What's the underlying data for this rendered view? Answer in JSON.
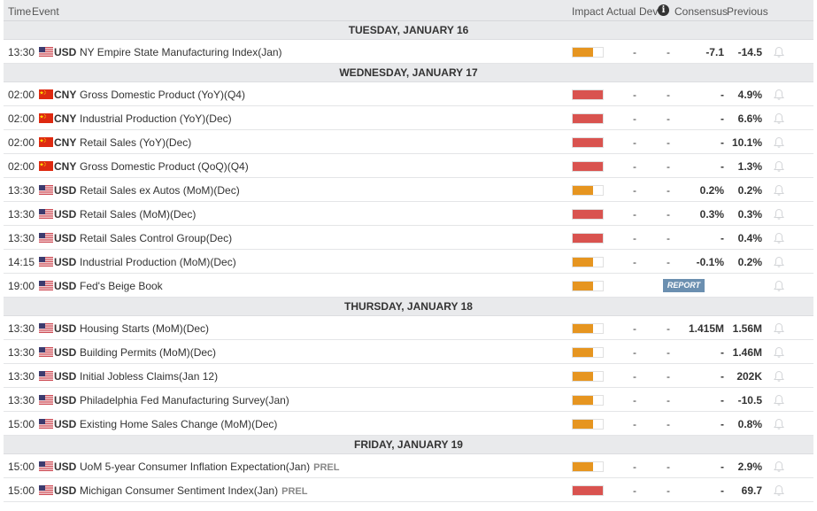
{
  "header": {
    "time": "Time",
    "event": "Event",
    "impact": "Impact",
    "actual": "Actual",
    "dev": "Dev",
    "info_icon": "i",
    "consensus": "Consensus",
    "previous": "Previous"
  },
  "colors": {
    "impact_high": "#d9534f",
    "impact_medium": "#e69520",
    "report_badge": "#6b8fb0"
  },
  "days": [
    {
      "label": "TUESDAY, JANUARY 16",
      "rows": [
        {
          "time": "13:30",
          "flag": "us-flag-icon",
          "ccy": "USD",
          "event": "NY Empire State Manufacturing Index(Jan)",
          "prel": "",
          "impact": "medium",
          "impact_level": 0.67,
          "actual": "-",
          "dev": "-",
          "consensus": "-7.1",
          "previous": "-14.5"
        }
      ]
    },
    {
      "label": "WEDNESDAY, JANUARY 17",
      "rows": [
        {
          "time": "02:00",
          "flag": "cn-flag-icon",
          "ccy": "CNY",
          "event": "Gross Domestic Product (YoY)(Q4)",
          "prel": "",
          "impact": "high",
          "impact_level": 1,
          "actual": "-",
          "dev": "-",
          "consensus": "-",
          "previous": "4.9%"
        },
        {
          "time": "02:00",
          "flag": "cn-flag-icon",
          "ccy": "CNY",
          "event": "Industrial Production (YoY)(Dec)",
          "prel": "",
          "impact": "high",
          "impact_level": 1,
          "actual": "-",
          "dev": "-",
          "consensus": "-",
          "previous": "6.6%"
        },
        {
          "time": "02:00",
          "flag": "cn-flag-icon",
          "ccy": "CNY",
          "event": "Retail Sales (YoY)(Dec)",
          "prel": "",
          "impact": "high",
          "impact_level": 1,
          "actual": "-",
          "dev": "-",
          "consensus": "-",
          "previous": "10.1%"
        },
        {
          "time": "02:00",
          "flag": "cn-flag-icon",
          "ccy": "CNY",
          "event": "Gross Domestic Product (QoQ)(Q4)",
          "prel": "",
          "impact": "high",
          "impact_level": 1,
          "actual": "-",
          "dev": "-",
          "consensus": "-",
          "previous": "1.3%"
        },
        {
          "time": "13:30",
          "flag": "us-flag-icon",
          "ccy": "USD",
          "event": "Retail Sales ex Autos (MoM)(Dec)",
          "prel": "",
          "impact": "medium",
          "impact_level": 0.67,
          "actual": "-",
          "dev": "-",
          "consensus": "0.2%",
          "previous": "0.2%"
        },
        {
          "time": "13:30",
          "flag": "us-flag-icon",
          "ccy": "USD",
          "event": "Retail Sales (MoM)(Dec)",
          "prel": "",
          "impact": "high",
          "impact_level": 1,
          "actual": "-",
          "dev": "-",
          "consensus": "0.3%",
          "previous": "0.3%"
        },
        {
          "time": "13:30",
          "flag": "us-flag-icon",
          "ccy": "USD",
          "event": "Retail Sales Control Group(Dec)",
          "prel": "",
          "impact": "high",
          "impact_level": 1,
          "actual": "-",
          "dev": "-",
          "consensus": "-",
          "previous": "0.4%"
        },
        {
          "time": "14:15",
          "flag": "us-flag-icon",
          "ccy": "USD",
          "event": "Industrial Production (MoM)(Dec)",
          "prel": "",
          "impact": "medium",
          "impact_level": 0.67,
          "actual": "-",
          "dev": "-",
          "consensus": "-0.1%",
          "previous": "0.2%"
        },
        {
          "time": "19:00",
          "flag": "us-flag-icon",
          "ccy": "USD",
          "event": "Fed's Beige Book",
          "prel": "",
          "impact": "medium",
          "impact_level": 0.67,
          "report": "REPORT"
        }
      ]
    },
    {
      "label": "THURSDAY, JANUARY 18",
      "rows": [
        {
          "time": "13:30",
          "flag": "us-flag-icon",
          "ccy": "USD",
          "event": "Housing Starts (MoM)(Dec)",
          "prel": "",
          "impact": "medium",
          "impact_level": 0.67,
          "actual": "-",
          "dev": "-",
          "consensus": "1.415M",
          "previous": "1.56M"
        },
        {
          "time": "13:30",
          "flag": "us-flag-icon",
          "ccy": "USD",
          "event": "Building Permits (MoM)(Dec)",
          "prel": "",
          "impact": "medium",
          "impact_level": 0.67,
          "actual": "-",
          "dev": "-",
          "consensus": "-",
          "previous": "1.46M"
        },
        {
          "time": "13:30",
          "flag": "us-flag-icon",
          "ccy": "USD",
          "event": "Initial Jobless Claims(Jan 12)",
          "prel": "",
          "impact": "medium",
          "impact_level": 0.67,
          "actual": "-",
          "dev": "-",
          "consensus": "-",
          "previous": "202K"
        },
        {
          "time": "13:30",
          "flag": "us-flag-icon",
          "ccy": "USD",
          "event": "Philadelphia Fed Manufacturing Survey(Jan)",
          "prel": "",
          "impact": "medium",
          "impact_level": 0.67,
          "actual": "-",
          "dev": "-",
          "consensus": "-",
          "previous": "-10.5"
        },
        {
          "time": "15:00",
          "flag": "us-flag-icon",
          "ccy": "USD",
          "event": "Existing Home Sales Change (MoM)(Dec)",
          "prel": "",
          "impact": "medium",
          "impact_level": 0.67,
          "actual": "-",
          "dev": "-",
          "consensus": "-",
          "previous": "0.8%"
        }
      ]
    },
    {
      "label": "FRIDAY, JANUARY 19",
      "rows": [
        {
          "time": "15:00",
          "flag": "us-flag-icon",
          "ccy": "USD",
          "event": "UoM 5-year Consumer Inflation Expectation(Jan)",
          "prel": "PREL",
          "impact": "medium",
          "impact_level": 0.67,
          "actual": "-",
          "dev": "-",
          "consensus": "-",
          "previous": "2.9%"
        },
        {
          "time": "15:00",
          "flag": "us-flag-icon",
          "ccy": "USD",
          "event": "Michigan Consumer Sentiment Index(Jan)",
          "prel": "PREL",
          "impact": "high",
          "impact_level": 1,
          "actual": "-",
          "dev": "-",
          "consensus": "-",
          "previous": "69.7"
        }
      ]
    }
  ]
}
